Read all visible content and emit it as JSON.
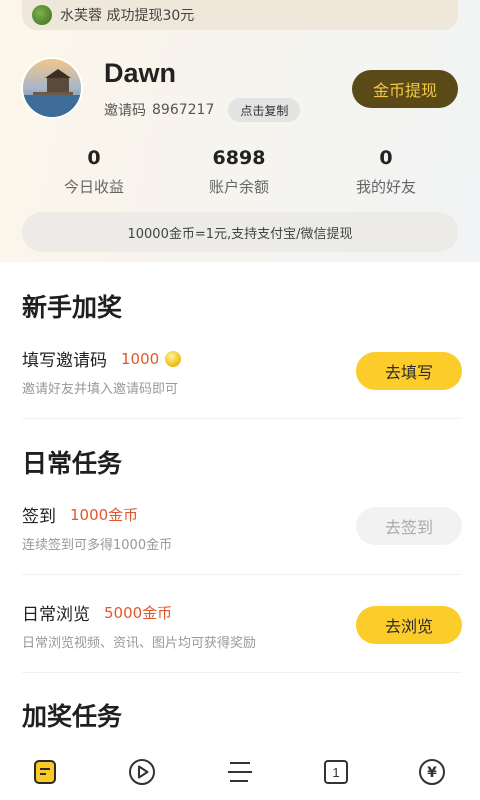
{
  "ticker": {
    "text": "水芙蓉 成功提现30元"
  },
  "profile": {
    "username": "Dawn",
    "invite_label": "邀请码",
    "invite_code": "8967217",
    "copy_label": "点击复制",
    "withdraw_label": "金币提现"
  },
  "stats": [
    {
      "value": "0",
      "label": "今日收益"
    },
    {
      "value": "6898",
      "label": "账户余额"
    },
    {
      "value": "0",
      "label": "我的好友"
    }
  ],
  "rate_text": "10000金币=1元,支持支付宝/微信提现",
  "sections": {
    "newbie": {
      "title": "新手加奖",
      "task": {
        "title": "填写邀请码",
        "reward": "1000",
        "desc": "邀请好友并填入邀请码即可",
        "button": "去填写"
      }
    },
    "daily": {
      "title": "日常任务",
      "tasks": [
        {
          "title": "签到",
          "reward": "1000金币",
          "desc": "连续签到可多得1000金币",
          "button": "去签到"
        },
        {
          "title": "日常浏览",
          "reward": "5000金币",
          "desc": "日常浏览视频、资讯、图片均可获得奖励",
          "button": "去浏览"
        }
      ]
    },
    "bonus": {
      "title": "加奖任务"
    }
  },
  "tabbar": {
    "icons": [
      "document-icon",
      "play-icon",
      "menu-icon",
      "page-one-icon",
      "yuan-icon"
    ],
    "page_badge": "1",
    "yuan_symbol": "¥"
  },
  "colors": {
    "accent_yellow": "#fccc2b",
    "reward_red": "#e0572b",
    "withdraw_bg": "#5a4a18",
    "withdraw_text": "#f4c842"
  }
}
